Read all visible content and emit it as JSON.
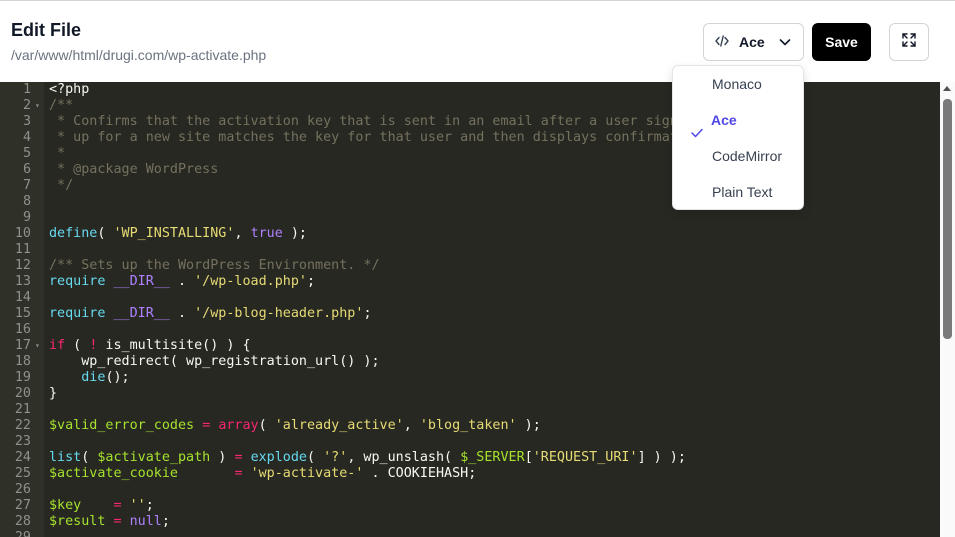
{
  "header": {
    "title": "Edit File",
    "path": "/var/www/html/drugi.com/wp-activate.php",
    "editor_label": "Ace",
    "save_label": "Save",
    "editor_icon": "code-icon",
    "fullscreen_icon": "expand-icon"
  },
  "dropdown": {
    "options": [
      {
        "label": "Monaco",
        "selected": false
      },
      {
        "label": "Ace",
        "selected": true
      },
      {
        "label": "CodeMirror",
        "selected": false
      },
      {
        "label": "Plain Text",
        "selected": false
      }
    ]
  },
  "colors": {
    "editor_bg": "#272822",
    "gutter_bg": "#2f3129",
    "comment": "#75715e",
    "keyword": "#66d9ef",
    "operator": "#f92672",
    "string": "#e6db74",
    "variable": "#a6e22e",
    "constant": "#ae81ff",
    "accent": "#4f46e5"
  },
  "code_lines": [
    {
      "n": "1",
      "fold": false,
      "tokens": [
        [
          "plain",
          "<?php"
        ]
      ]
    },
    {
      "n": "2",
      "fold": true,
      "tokens": [
        [
          "cm",
          "/**"
        ]
      ]
    },
    {
      "n": "3",
      "fold": false,
      "tokens": [
        [
          "cm",
          " * Confirms that the activation key that is sent in an email after a user signs"
        ]
      ]
    },
    {
      "n": "4",
      "fold": false,
      "tokens": [
        [
          "cm",
          " * up for a new site matches the key for that user and then displays confirmation."
        ]
      ]
    },
    {
      "n": "5",
      "fold": false,
      "tokens": [
        [
          "cm",
          " *"
        ]
      ]
    },
    {
      "n": "6",
      "fold": false,
      "tokens": [
        [
          "cm",
          " * @package WordPress"
        ]
      ]
    },
    {
      "n": "7",
      "fold": false,
      "tokens": [
        [
          "cm",
          " */"
        ]
      ]
    },
    {
      "n": "8",
      "fold": false,
      "tokens": []
    },
    {
      "n": "9",
      "fold": false,
      "tokens": []
    },
    {
      "n": "10",
      "fold": false,
      "tokens": [
        [
          "fn",
          "define"
        ],
        [
          "plain",
          "( "
        ],
        [
          "str",
          "'WP_INSTALLING'"
        ],
        [
          "plain",
          ", "
        ],
        [
          "num",
          "true"
        ],
        [
          "plain",
          " );"
        ]
      ]
    },
    {
      "n": "11",
      "fold": false,
      "tokens": []
    },
    {
      "n": "12",
      "fold": false,
      "tokens": [
        [
          "cm",
          "/** Sets up the WordPress Environment. */"
        ]
      ]
    },
    {
      "n": "13",
      "fold": false,
      "tokens": [
        [
          "kw",
          "require"
        ],
        [
          "plain",
          " "
        ],
        [
          "num",
          "__DIR__"
        ],
        [
          "plain",
          " . "
        ],
        [
          "str",
          "'/wp-load.php'"
        ],
        [
          "plain",
          ";"
        ]
      ]
    },
    {
      "n": "14",
      "fold": false,
      "tokens": []
    },
    {
      "n": "15",
      "fold": false,
      "tokens": [
        [
          "kw",
          "require"
        ],
        [
          "plain",
          " "
        ],
        [
          "num",
          "__DIR__"
        ],
        [
          "plain",
          " . "
        ],
        [
          "str",
          "'/wp-blog-header.php'"
        ],
        [
          "plain",
          ";"
        ]
      ]
    },
    {
      "n": "16",
      "fold": false,
      "tokens": []
    },
    {
      "n": "17",
      "fold": true,
      "tokens": [
        [
          "op",
          "if"
        ],
        [
          "plain",
          " ( "
        ],
        [
          "op",
          "!"
        ],
        [
          "plain",
          " is_multisite() ) {"
        ]
      ]
    },
    {
      "n": "18",
      "fold": false,
      "tokens": [
        [
          "plain",
          "    wp_redirect( wp_registration_url() );"
        ]
      ]
    },
    {
      "n": "19",
      "fold": false,
      "tokens": [
        [
          "plain",
          "    "
        ],
        [
          "fn",
          "die"
        ],
        [
          "plain",
          "();"
        ]
      ]
    },
    {
      "n": "20",
      "fold": false,
      "tokens": [
        [
          "plain",
          "}"
        ]
      ]
    },
    {
      "n": "21",
      "fold": false,
      "tokens": []
    },
    {
      "n": "22",
      "fold": false,
      "tokens": [
        [
          "var",
          "$valid_error_codes"
        ],
        [
          "plain",
          " "
        ],
        [
          "op",
          "="
        ],
        [
          "plain",
          " "
        ],
        [
          "op",
          "array"
        ],
        [
          "plain",
          "( "
        ],
        [
          "str",
          "'already_active'"
        ],
        [
          "plain",
          ", "
        ],
        [
          "str",
          "'blog_taken'"
        ],
        [
          "plain",
          " );"
        ]
      ]
    },
    {
      "n": "23",
      "fold": false,
      "tokens": []
    },
    {
      "n": "24",
      "fold": false,
      "tokens": [
        [
          "fn",
          "list"
        ],
        [
          "plain",
          "( "
        ],
        [
          "var",
          "$activate_path"
        ],
        [
          "plain",
          " ) "
        ],
        [
          "op",
          "="
        ],
        [
          "plain",
          " "
        ],
        [
          "fn",
          "explode"
        ],
        [
          "plain",
          "( "
        ],
        [
          "str",
          "'?'"
        ],
        [
          "plain",
          ", wp_unslash( "
        ],
        [
          "var",
          "$_SERVER"
        ],
        [
          "plain",
          "["
        ],
        [
          "str",
          "'REQUEST_URI'"
        ],
        [
          "plain",
          "] ) );"
        ]
      ]
    },
    {
      "n": "25",
      "fold": false,
      "tokens": [
        [
          "var",
          "$activate_cookie"
        ],
        [
          "plain",
          "       "
        ],
        [
          "op",
          "="
        ],
        [
          "plain",
          " "
        ],
        [
          "str",
          "'wp-activate-'"
        ],
        [
          "plain",
          " . COOKIEHASH;"
        ]
      ]
    },
    {
      "n": "26",
      "fold": false,
      "tokens": []
    },
    {
      "n": "27",
      "fold": false,
      "tokens": [
        [
          "var",
          "$key"
        ],
        [
          "plain",
          "    "
        ],
        [
          "op",
          "="
        ],
        [
          "plain",
          " "
        ],
        [
          "str",
          "''"
        ],
        [
          "plain",
          ";"
        ]
      ]
    },
    {
      "n": "28",
      "fold": false,
      "tokens": [
        [
          "var",
          "$result"
        ],
        [
          "plain",
          " "
        ],
        [
          "op",
          "="
        ],
        [
          "plain",
          " "
        ],
        [
          "num",
          "null"
        ],
        [
          "plain",
          ";"
        ]
      ]
    },
    {
      "n": "29",
      "fold": false,
      "tokens": []
    }
  ]
}
